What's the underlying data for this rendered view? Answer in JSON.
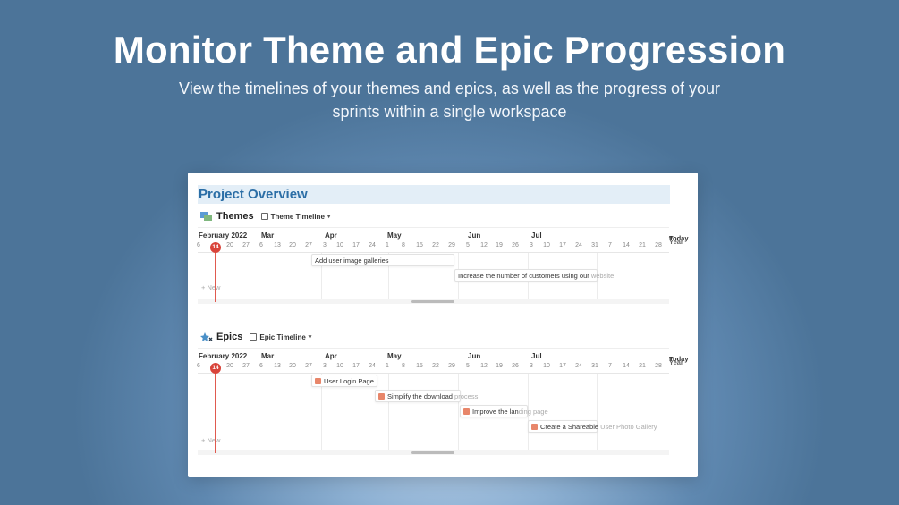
{
  "hero": {
    "title": "Monitor Theme and Epic Progression",
    "subtitle": "View the timelines of your themes and epics, as well as the progress of your sprints within a single workspace"
  },
  "page": {
    "title": "Project Overview"
  },
  "themes": {
    "title": "Themes",
    "view_label": "Theme Timeline",
    "new_label": "New",
    "items": [
      {
        "label": "Add user image galleries",
        "tail": ""
      },
      {
        "label": "Increase the number of customers using our",
        "tail": " website"
      }
    ]
  },
  "epics": {
    "title": "Epics",
    "view_label": "Epic Timeline",
    "new_label": "New",
    "items": [
      {
        "label": "User Login Page",
        "tail": ""
      },
      {
        "label": "Simplify the download",
        "tail": " process"
      },
      {
        "label": "Improve the lan",
        "tail": "ding page"
      },
      {
        "label": "Create a Shareable",
        "tail": " User Photo Gallery"
      }
    ]
  },
  "timeline": {
    "months": [
      "February 2022",
      "Mar",
      "Apr",
      "May",
      "Jun",
      "Jul"
    ],
    "days": [
      "6",
      "20",
      "27",
      "6",
      "13",
      "20",
      "27",
      "3",
      "10",
      "17",
      "24",
      "1",
      "8",
      "15",
      "22",
      "29",
      "5",
      "12",
      "19",
      "26",
      "3",
      "10",
      "17",
      "24",
      "31",
      "7",
      "14",
      "21",
      "28"
    ],
    "today_badge": "14",
    "zoom_label": "Year",
    "today_label": "Today"
  },
  "colors": {
    "accent": "#2b6ea6",
    "today_marker": "#d9443a",
    "header_bg": "#e3eef7"
  }
}
